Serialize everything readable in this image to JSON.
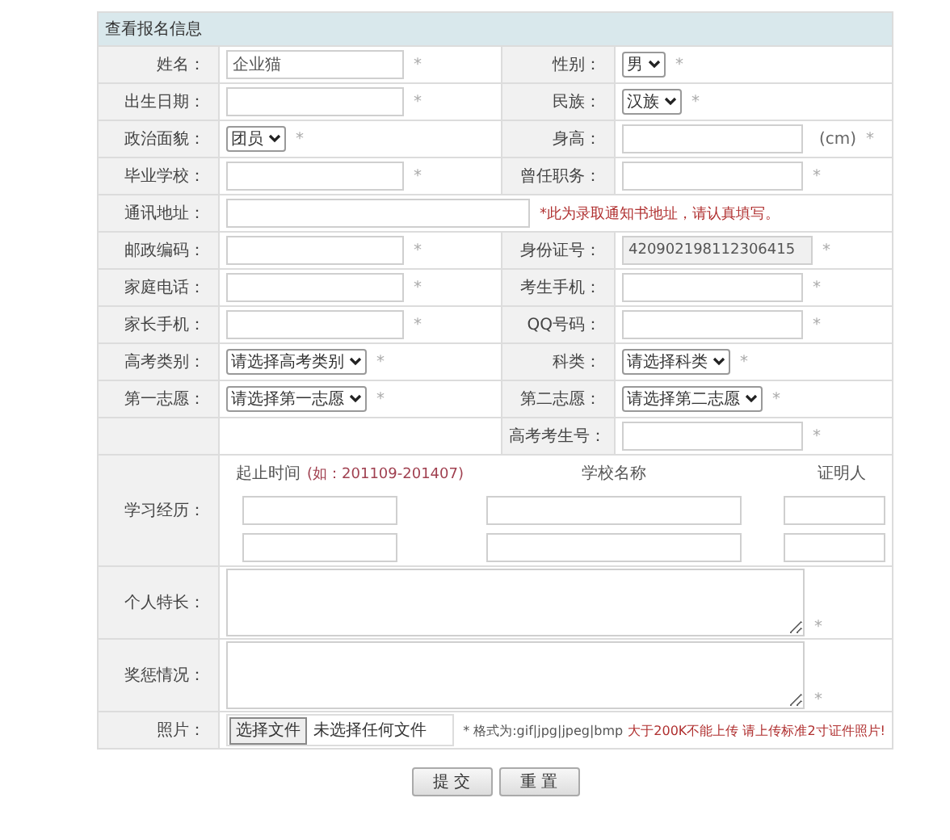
{
  "title": "查看报名信息",
  "rows": [
    {
      "fields": [
        {
          "label": "姓名：",
          "kind": "text",
          "value": "企业猫",
          "mark": "*"
        },
        {
          "label": "性别：",
          "kind": "select",
          "value": "男",
          "mark": "*"
        }
      ]
    },
    {
      "fields": [
        {
          "label": "出生日期：",
          "kind": "text",
          "mark": "*"
        },
        {
          "label": "民族：",
          "kind": "select",
          "value": "汉族",
          "mark": "*"
        }
      ]
    },
    {
      "fields": [
        {
          "label": "政治面貌：",
          "kind": "select",
          "value": "团员",
          "mark": "*"
        },
        {
          "label": "身高：",
          "kind": "text",
          "unit": "(cm)",
          "mark": "*"
        }
      ]
    },
    {
      "fields": [
        {
          "label": "毕业学校：",
          "kind": "text",
          "mark": "*"
        },
        {
          "label": "曾任职务：",
          "kind": "text",
          "mark": "*"
        }
      ]
    },
    {
      "fields": [
        {
          "label": "通讯地址：",
          "kind": "wide",
          "note": "*此为录取通知书地址，请认真填写。"
        }
      ]
    },
    {
      "fields": [
        {
          "label": "邮政编码：",
          "kind": "text",
          "mark": "*"
        },
        {
          "label": "身份证号：",
          "kind": "readonly",
          "value": "420902198112306415",
          "mark": "*"
        }
      ]
    },
    {
      "fields": [
        {
          "label": "家庭电话：",
          "kind": "text",
          "mark": "*"
        },
        {
          "label": "考生手机：",
          "kind": "text",
          "mark": "*"
        }
      ]
    },
    {
      "fields": [
        {
          "label": "家长手机：",
          "kind": "text",
          "mark": "*"
        },
        {
          "label": "QQ号码：",
          "kind": "text",
          "mark": "*"
        }
      ]
    },
    {
      "fields": [
        {
          "label": "高考类别：",
          "kind": "select",
          "value": "请选择高考类别",
          "mark": "*"
        },
        {
          "label": "科类：",
          "kind": "select",
          "value": "请选择科类",
          "mark": "*"
        }
      ]
    },
    {
      "fields": [
        {
          "label": "第一志愿：",
          "kind": "select",
          "value": "请选择第一志愿",
          "mark": "*"
        },
        {
          "label": "第二志愿：",
          "kind": "select",
          "value": "请选择第二志愿",
          "mark": "*"
        }
      ]
    },
    {
      "fields": [
        {
          "kind": "blank"
        },
        {
          "label": "高考考生号：",
          "kind": "text",
          "mark": "*"
        }
      ]
    }
  ],
  "education": {
    "label": "学习经历：",
    "headers": [
      "起止时间",
      "学校名称",
      "证明人"
    ],
    "hint": "(如：201109-201407)",
    "entries": [
      {
        "kind": "empty"
      },
      {
        "kind": "empty"
      }
    ]
  },
  "areas": [
    {
      "label": "个人特长：",
      "mark": "*"
    },
    {
      "label": "奖惩情况：",
      "mark": "*"
    }
  ],
  "photo": {
    "label": "照片：",
    "button": "选择文件",
    "value": "未选择任何文件",
    "note": "* 格式为:gif|jpg|jpeg|bmp",
    "warning": "大于200K不能上传 请上传标准2寸证件照片!"
  },
  "buttons": [
    "提 交",
    "重 置"
  ]
}
